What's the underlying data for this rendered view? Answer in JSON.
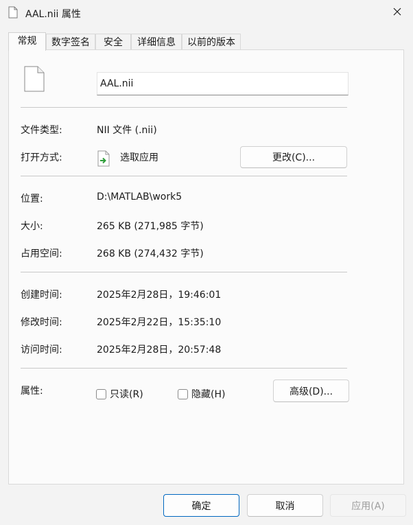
{
  "window": {
    "title": "AAL.nii 属性",
    "icons": {
      "title": "document-icon",
      "close": "close-icon"
    }
  },
  "tabs": [
    {
      "label": "常规",
      "active": true
    },
    {
      "label": "数字签名"
    },
    {
      "label": "安全"
    },
    {
      "label": "详细信息"
    },
    {
      "label": "以前的版本"
    }
  ],
  "general": {
    "file_icon": "document-icon",
    "file_name": "AAL.nii",
    "file_type_label": "文件类型:",
    "file_type_value": "NII 文件 (.nii)",
    "open_with_label": "打开方式:",
    "open_with_icon": "green-arrow-file-icon",
    "open_with_value": "选取应用",
    "change_button": "更改(C)...",
    "location_label": "位置:",
    "location_value": "D:\\MATLAB\\work5",
    "size_label": "大小:",
    "size_value": "265 KB (271,985 字节)",
    "disk_size_label": "占用空间:",
    "disk_size_value": "268 KB (274,432 字节)",
    "created_label": "创建时间:",
    "created_value": "2025年2月28日，19:46:01",
    "modified_label": "修改时间:",
    "modified_value": "2025年2月22日，15:35:10",
    "accessed_label": "访问时间:",
    "accessed_value": "2025年2月28日，20:57:48",
    "attributes_label": "属性:",
    "readonly_label": "只读(R)",
    "readonly_checked": false,
    "hidden_label": "隐藏(H)",
    "hidden_checked": false,
    "advanced_button": "高级(D)..."
  },
  "footer": {
    "ok": "确定",
    "cancel": "取消",
    "apply": "应用(A)",
    "apply_disabled": true
  },
  "colors": {
    "primary_border": "#0067c0",
    "open_with_arrow": "#2f9e3a"
  }
}
